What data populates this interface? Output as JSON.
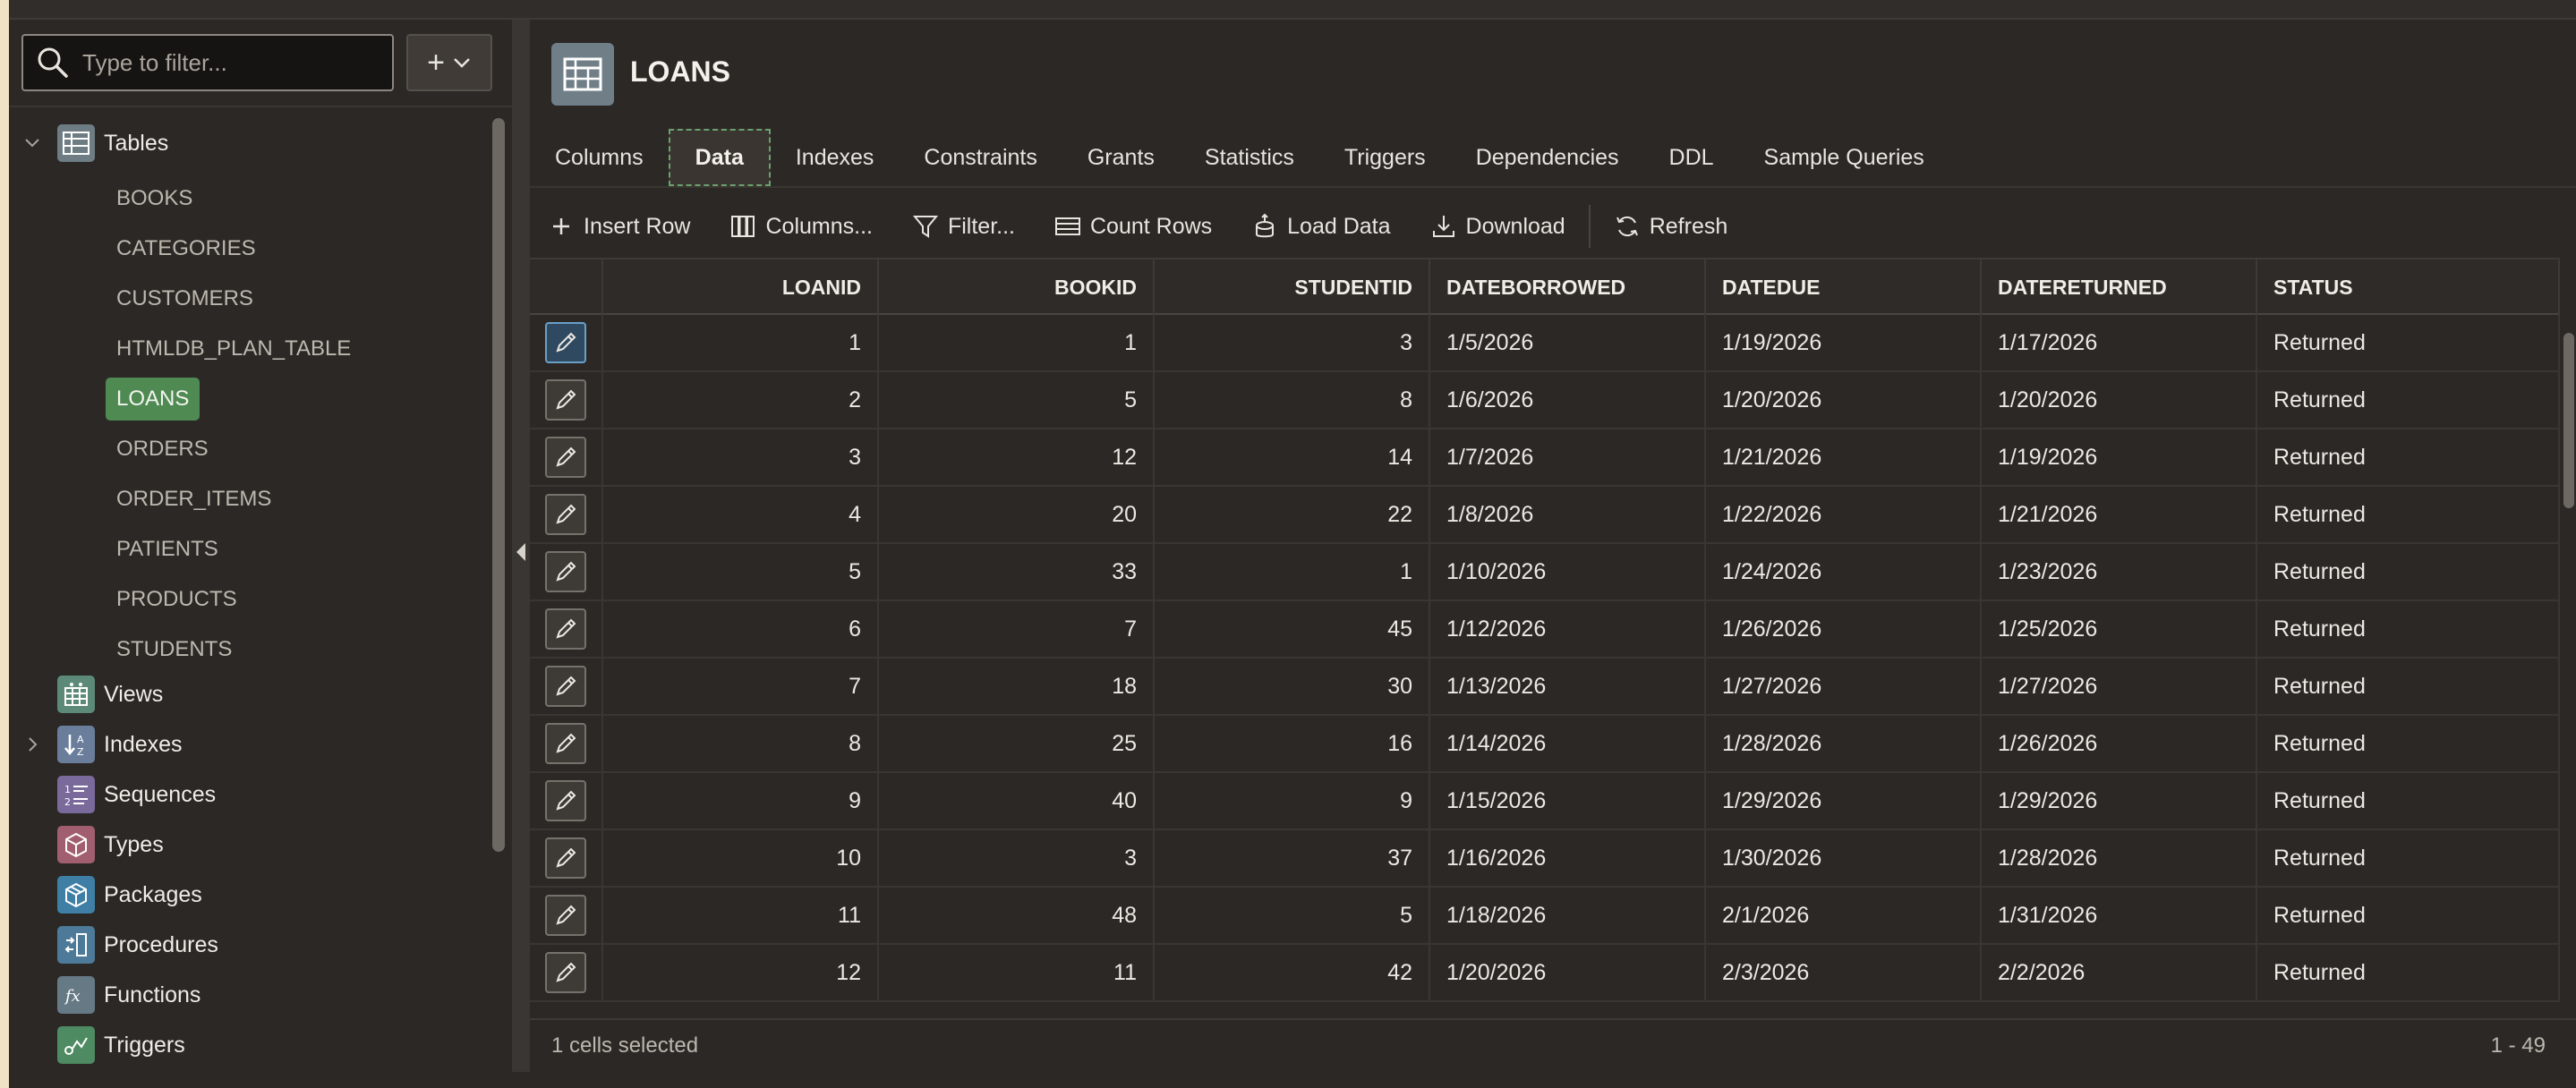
{
  "sidebar": {
    "filter_placeholder": "Type to filter...",
    "add_label": "+",
    "categories": {
      "tables": "Tables",
      "views": "Views",
      "indexes": "Indexes",
      "sequences": "Sequences",
      "types": "Types",
      "packages": "Packages",
      "procedures": "Procedures",
      "functions": "Functions",
      "triggers": "Triggers"
    },
    "tables": [
      "BOOKS",
      "CATEGORIES",
      "CUSTOMERS",
      "HTMLDB_PLAN_TABLE",
      "LOANS",
      "ORDERS",
      "ORDER_ITEMS",
      "PATIENTS",
      "PRODUCTS",
      "STUDENTS"
    ],
    "selected_table": "LOANS"
  },
  "object": {
    "title": "LOANS"
  },
  "tabs": [
    "Columns",
    "Data",
    "Indexes",
    "Constraints",
    "Grants",
    "Statistics",
    "Triggers",
    "Dependencies",
    "DDL",
    "Sample Queries"
  ],
  "active_tab": "Data",
  "toolbar": {
    "insert_row": "Insert Row",
    "columns": "Columns...",
    "filter": "Filter...",
    "count_rows": "Count Rows",
    "load_data": "Load Data",
    "download": "Download",
    "refresh": "Refresh"
  },
  "grid": {
    "columns": [
      "LOANID",
      "BOOKID",
      "STUDENTID",
      "DATEBORROWED",
      "DATEDUE",
      "DATERETURNED",
      "STATUS"
    ],
    "rows": [
      [
        "1",
        "1",
        "3",
        "1/5/2026",
        "1/19/2026",
        "1/17/2026",
        "Returned"
      ],
      [
        "2",
        "5",
        "8",
        "1/6/2026",
        "1/20/2026",
        "1/20/2026",
        "Returned"
      ],
      [
        "3",
        "12",
        "14",
        "1/7/2026",
        "1/21/2026",
        "1/19/2026",
        "Returned"
      ],
      [
        "4",
        "20",
        "22",
        "1/8/2026",
        "1/22/2026",
        "1/21/2026",
        "Returned"
      ],
      [
        "5",
        "33",
        "1",
        "1/10/2026",
        "1/24/2026",
        "1/23/2026",
        "Returned"
      ],
      [
        "6",
        "7",
        "45",
        "1/12/2026",
        "1/26/2026",
        "1/25/2026",
        "Returned"
      ],
      [
        "7",
        "18",
        "30",
        "1/13/2026",
        "1/27/2026",
        "1/27/2026",
        "Returned"
      ],
      [
        "8",
        "25",
        "16",
        "1/14/2026",
        "1/28/2026",
        "1/26/2026",
        "Returned"
      ],
      [
        "9",
        "40",
        "9",
        "1/15/2026",
        "1/29/2026",
        "1/29/2026",
        "Returned"
      ],
      [
        "10",
        "3",
        "37",
        "1/16/2026",
        "1/30/2026",
        "1/28/2026",
        "Returned"
      ],
      [
        "11",
        "48",
        "5",
        "1/18/2026",
        "2/1/2026",
        "1/31/2026",
        "Returned"
      ],
      [
        "12",
        "11",
        "42",
        "1/20/2026",
        "2/3/2026",
        "2/2/2026",
        "Returned"
      ]
    ]
  },
  "footer": {
    "selection": "1 cells selected",
    "range": "1 - 49"
  },
  "colors": {
    "accent_selected": "#4e8a52",
    "background": "#2b2826",
    "outer_frame": "#f0e2c4"
  }
}
